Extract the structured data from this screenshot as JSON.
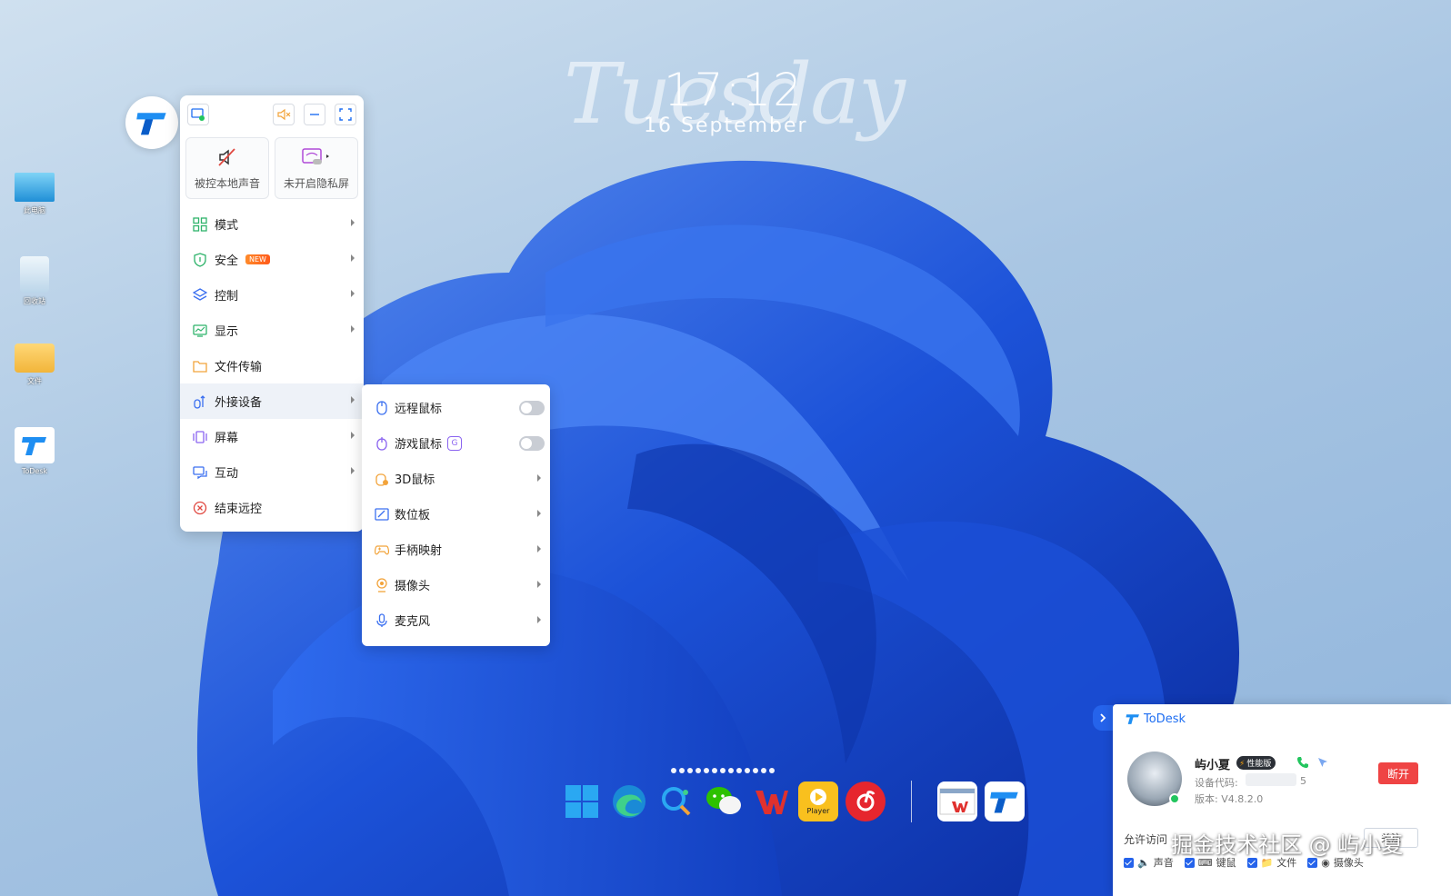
{
  "desktop": {
    "clock": {
      "day": "Tuesday",
      "time": "17:12",
      "date": "16 September"
    },
    "icons": [
      {
        "label": "此电脑"
      },
      {
        "label": "回收站"
      },
      {
        "label": "文件"
      },
      {
        "label": "ToDesk"
      }
    ]
  },
  "menu": {
    "top_buttons": [
      "screen-switch-icon",
      "mute-icon",
      "minimize-icon",
      "fullscreen-icon"
    ],
    "tiles": [
      {
        "label": "被控本地声音",
        "icon": "speaker-muted-icon"
      },
      {
        "label": "未开启隐私屏",
        "icon": "privacy-screen-icon"
      }
    ],
    "items": [
      {
        "label": "模式",
        "icon": "grid-icon",
        "arrow": true
      },
      {
        "label": "安全",
        "icon": "shield-icon",
        "badge": "NEW",
        "arrow": true
      },
      {
        "label": "控制",
        "icon": "layers-icon",
        "arrow": true
      },
      {
        "label": "显示",
        "icon": "monitor-chart-icon",
        "arrow": true
      },
      {
        "label": "文件传输",
        "icon": "folder-icon",
        "arrow": false
      },
      {
        "label": "外接设备",
        "icon": "peripheral-icon",
        "arrow": true,
        "active": true
      },
      {
        "label": "屏幕",
        "icon": "screens-icon",
        "arrow": true
      },
      {
        "label": "互动",
        "icon": "chat-icon",
        "arrow": true
      },
      {
        "label": "结束远控",
        "icon": "close-circle-icon",
        "arrow": false
      }
    ]
  },
  "submenu": {
    "items": [
      {
        "label": "远程鼠标",
        "icon": "mouse-icon",
        "toggle": false
      },
      {
        "label": "游戏鼠标",
        "icon": "game-mouse-icon",
        "badge": "G",
        "toggle": false
      },
      {
        "label": "3D鼠标",
        "icon": "3d-mouse-icon"
      },
      {
        "label": "数位板",
        "icon": "tablet-icon"
      },
      {
        "label": "手柄映射",
        "icon": "gamepad-icon"
      },
      {
        "label": "摄像头",
        "icon": "camera-icon"
      },
      {
        "label": "麦克风",
        "icon": "microphone-icon"
      }
    ]
  },
  "taskbar": {
    "apps": [
      "windows-start-icon",
      "edge-icon",
      "search-app-icon",
      "wechat-icon",
      "wps-icon",
      "potplayer-icon",
      "netease-music-icon"
    ],
    "player_label": "Player",
    "pinned": [
      "wps-file-icon",
      "todesk-icon"
    ]
  },
  "todesk_panel": {
    "brand": "ToDesk",
    "user": {
      "name": "屿小夏",
      "badge": "性能版",
      "device_code_label": "设备代码:",
      "device_code_suffix": "5",
      "version": "版本: V4.8.2.0"
    },
    "disconnect_label": "断开",
    "allow_label": "允许访问",
    "allow_button": "关注",
    "permissions": [
      {
        "label": "声音",
        "checked": true
      },
      {
        "label": "键鼠",
        "checked": true
      },
      {
        "label": "文件",
        "checked": true
      },
      {
        "label": "摄像头",
        "checked": true
      }
    ]
  },
  "watermark": "掘金技术社区 @ 屿小夏",
  "colors": {
    "accent": "#1e6ef2",
    "danger": "#ef4444",
    "menu_active": "#eef2f8"
  }
}
